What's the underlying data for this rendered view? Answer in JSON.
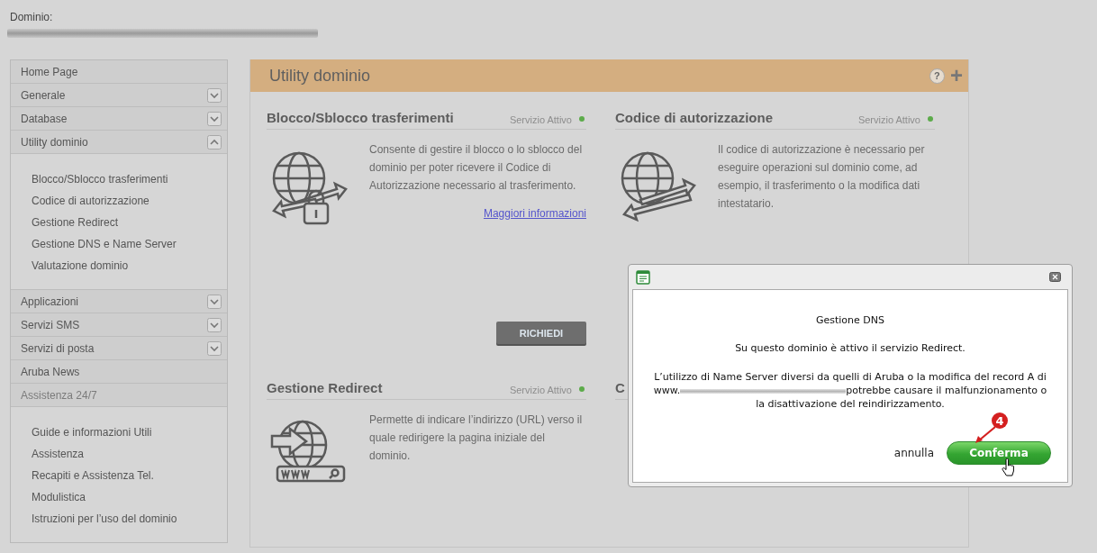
{
  "domain": {
    "label": "Dominio:"
  },
  "sidebar": {
    "items": [
      {
        "label": "Home Page",
        "kind": "plain"
      },
      {
        "label": "Generale",
        "kind": "toggle",
        "expanded": false
      },
      {
        "label": "Database",
        "kind": "toggle",
        "expanded": false
      },
      {
        "label": "Utility dominio",
        "kind": "toggle",
        "expanded": true,
        "children": [
          {
            "label": "Blocco/Sblocco trasferimenti"
          },
          {
            "label": "Codice di autorizzazione"
          },
          {
            "label": "Gestione Redirect"
          },
          {
            "label": "Gestione DNS e Name Server"
          },
          {
            "label": "Valutazione dominio"
          }
        ]
      },
      {
        "label": "Applicazioni",
        "kind": "toggle",
        "expanded": false
      },
      {
        "label": "Servizi SMS",
        "kind": "toggle",
        "expanded": false
      },
      {
        "label": "Servizi di posta",
        "kind": "toggle",
        "expanded": false
      },
      {
        "label": "Aruba News",
        "kind": "plain"
      },
      {
        "label": "Assistenza 24/7",
        "kind": "plain",
        "disabled": true,
        "children": [
          {
            "label": "Guide e informazioni Utili"
          },
          {
            "label": "Assistenza"
          },
          {
            "label": "Recapiti e Assistenza Tel."
          },
          {
            "label": "Modulistica"
          },
          {
            "label": "Istruzioni per l’uso del dominio"
          }
        ]
      }
    ]
  },
  "panel": {
    "title": "Utility dominio",
    "help": "?",
    "add": "+"
  },
  "cards": [
    {
      "title": "Blocco/Sblocco trasferimenti",
      "status": "Servizio Attivo",
      "kind": "lock",
      "description": "Consente di gestire il blocco o lo sblocco del dominio per poter ricevere il Codice di Autorizzazione necessario al trasferimento.",
      "link": "Maggiori informazioni",
      "button": "RICHIEDI"
    },
    {
      "title": "Codice di autorizzazione",
      "status": "Servizio Attivo",
      "kind": "transfer",
      "description": "Il codice di autorizzazione è necessario per eseguire operazioni sul dominio come, ad esempio, il trasferimento o la modifica dati intestatario."
    },
    {
      "title": "Gestione Redirect",
      "status": "Servizio Attivo",
      "kind": "www",
      "description": "Permette di indicare l’indirizzo (URL) verso il quale redirigere la pagina iniziale del dominio."
    },
    {
      "title": "C"
    }
  ],
  "dialog": {
    "title": "Gestione DNS",
    "message": "Su questo dominio è attivo il servizio Redirect.",
    "warning_start": "L’utilizzo di Name Server diversi da quelli di Aruba o la modifica del record A di www.",
    "warning_end": "potrebbe causare il malfunzionamento o la disattivazione del reindirizzamento.",
    "cancel": "annulla",
    "confirm": "Conferma",
    "step": "4"
  }
}
